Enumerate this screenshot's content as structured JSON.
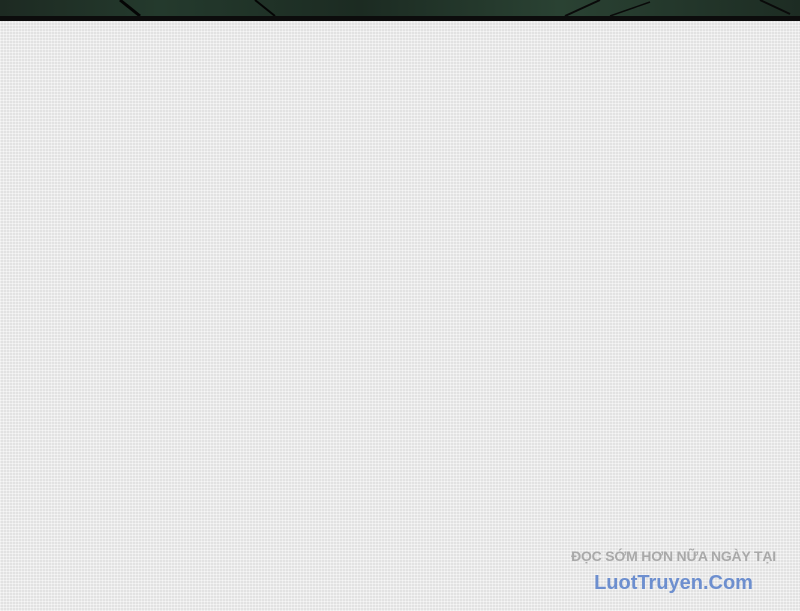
{
  "watermark": {
    "tagline": "ĐỌC SỚM HƠN NỮA NGÀY TẠI",
    "site": "LuotTruyen.Com",
    "tagline_color": "#a9a9a9",
    "site_color": "#6d8fcf"
  },
  "colors": {
    "paper": "#ececec",
    "border": "#0c0c0c",
    "art": "#243a2d"
  }
}
